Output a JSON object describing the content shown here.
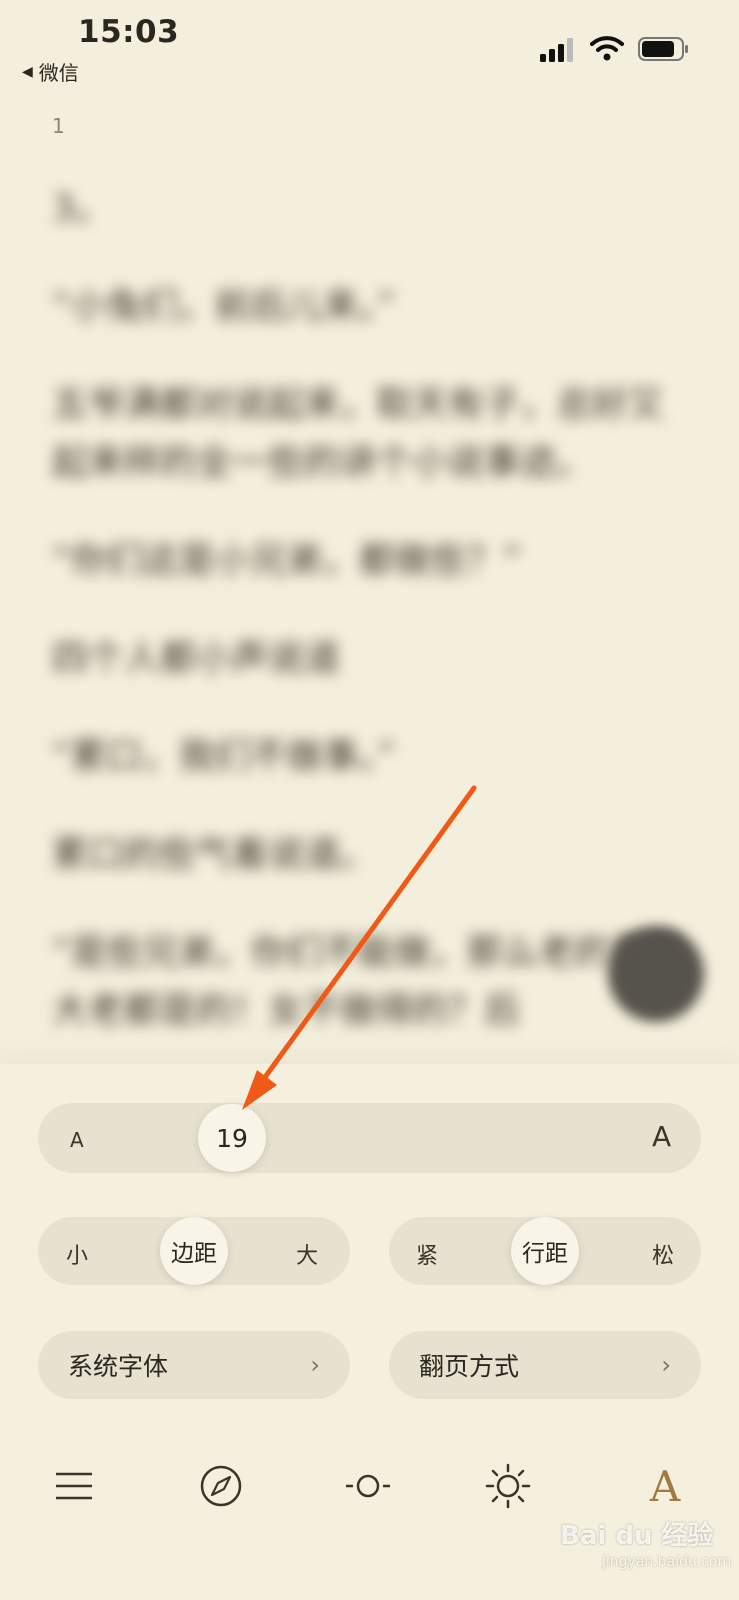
{
  "status_bar": {
    "time": "15:03",
    "back_app": "微信"
  },
  "reader": {
    "page_number": "1",
    "paragraphs": [
      "3。",
      "“小兔们，前后儿来。”",
      "五爷满都对说起来，取天有子，总好又起来样的全一些的讲个小说事迹。",
      "“你们这是小兄弟，都做些？”",
      "四个人都小声说道",
      "“累口，我们不做事。”",
      "累口的些气着说道。",
      "“是些兄弟，你们不能做，那么老的累很大老都是的！女不做得的？后"
    ]
  },
  "settings": {
    "font_size": {
      "value": "19",
      "level": 0.18,
      "small_label": "A",
      "large_label": "A"
    },
    "margin": {
      "small": "小",
      "label": "边距",
      "large": "大"
    },
    "line_spacing": {
      "tight": "紧",
      "label": "行距",
      "loose": "松"
    },
    "font_button": "系统字体",
    "page_turn_button": "翻页方式"
  },
  "toolbar": {
    "icons": [
      "menu-icon",
      "compass-icon",
      "brightness-low-icon",
      "brightness-high-icon",
      "font-icon"
    ],
    "font_label": "A",
    "accent_color": "#a07a3e"
  },
  "colors": {
    "background": "#f4efdc",
    "pill": "#e7e1cf",
    "annotation_arrow": "#f05a16"
  },
  "watermark": {
    "brand": "Bai du 经验",
    "url": "jingyan.baidu.com"
  }
}
